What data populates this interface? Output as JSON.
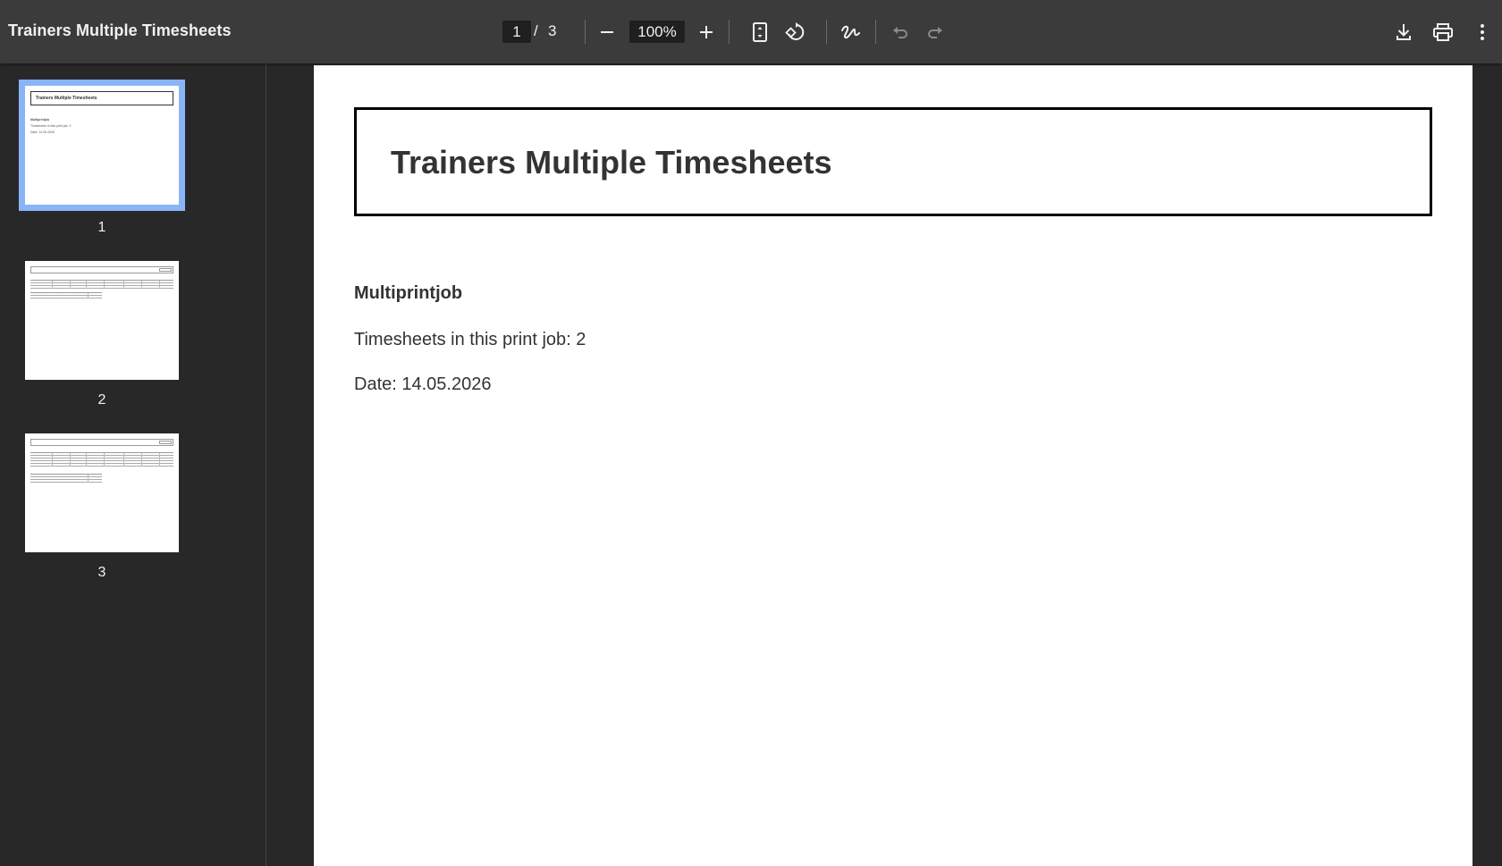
{
  "toolbar": {
    "title": "Trainers Multiple Timesheets",
    "current_page": "1",
    "separator": "/",
    "total_pages": "3",
    "zoom": "100%",
    "icons": {
      "zoom_out": "minus-icon",
      "zoom_in": "plus-icon",
      "fit": "fit-page-icon",
      "rotate": "rotate-icon",
      "annotate": "draw-icon",
      "undo": "undo-icon",
      "redo": "redo-icon",
      "download": "download-icon",
      "print": "print-icon",
      "more": "more-vertical-icon"
    }
  },
  "sidebar": {
    "thumbnails": [
      {
        "label": "1",
        "selected": true,
        "title": "Trainers Multiple Timesheets",
        "line1": "Multiprintjob",
        "line2": "Timesheets in this print job: 2",
        "line3": "Date: 14.05.2026"
      },
      {
        "label": "2",
        "selected": false
      },
      {
        "label": "3",
        "selected": false
      }
    ]
  },
  "document": {
    "title": "Trainers Multiple Timesheets",
    "section_heading": "Multiprintjob",
    "timesheets_line": "Timesheets in this print job: 2",
    "date_line": "Date: 14.05.2026"
  },
  "colors": {
    "toolbar_bg": "#3b3b3b",
    "viewer_bg": "#282828",
    "selected_thumb_outline": "#8ab4f8"
  }
}
